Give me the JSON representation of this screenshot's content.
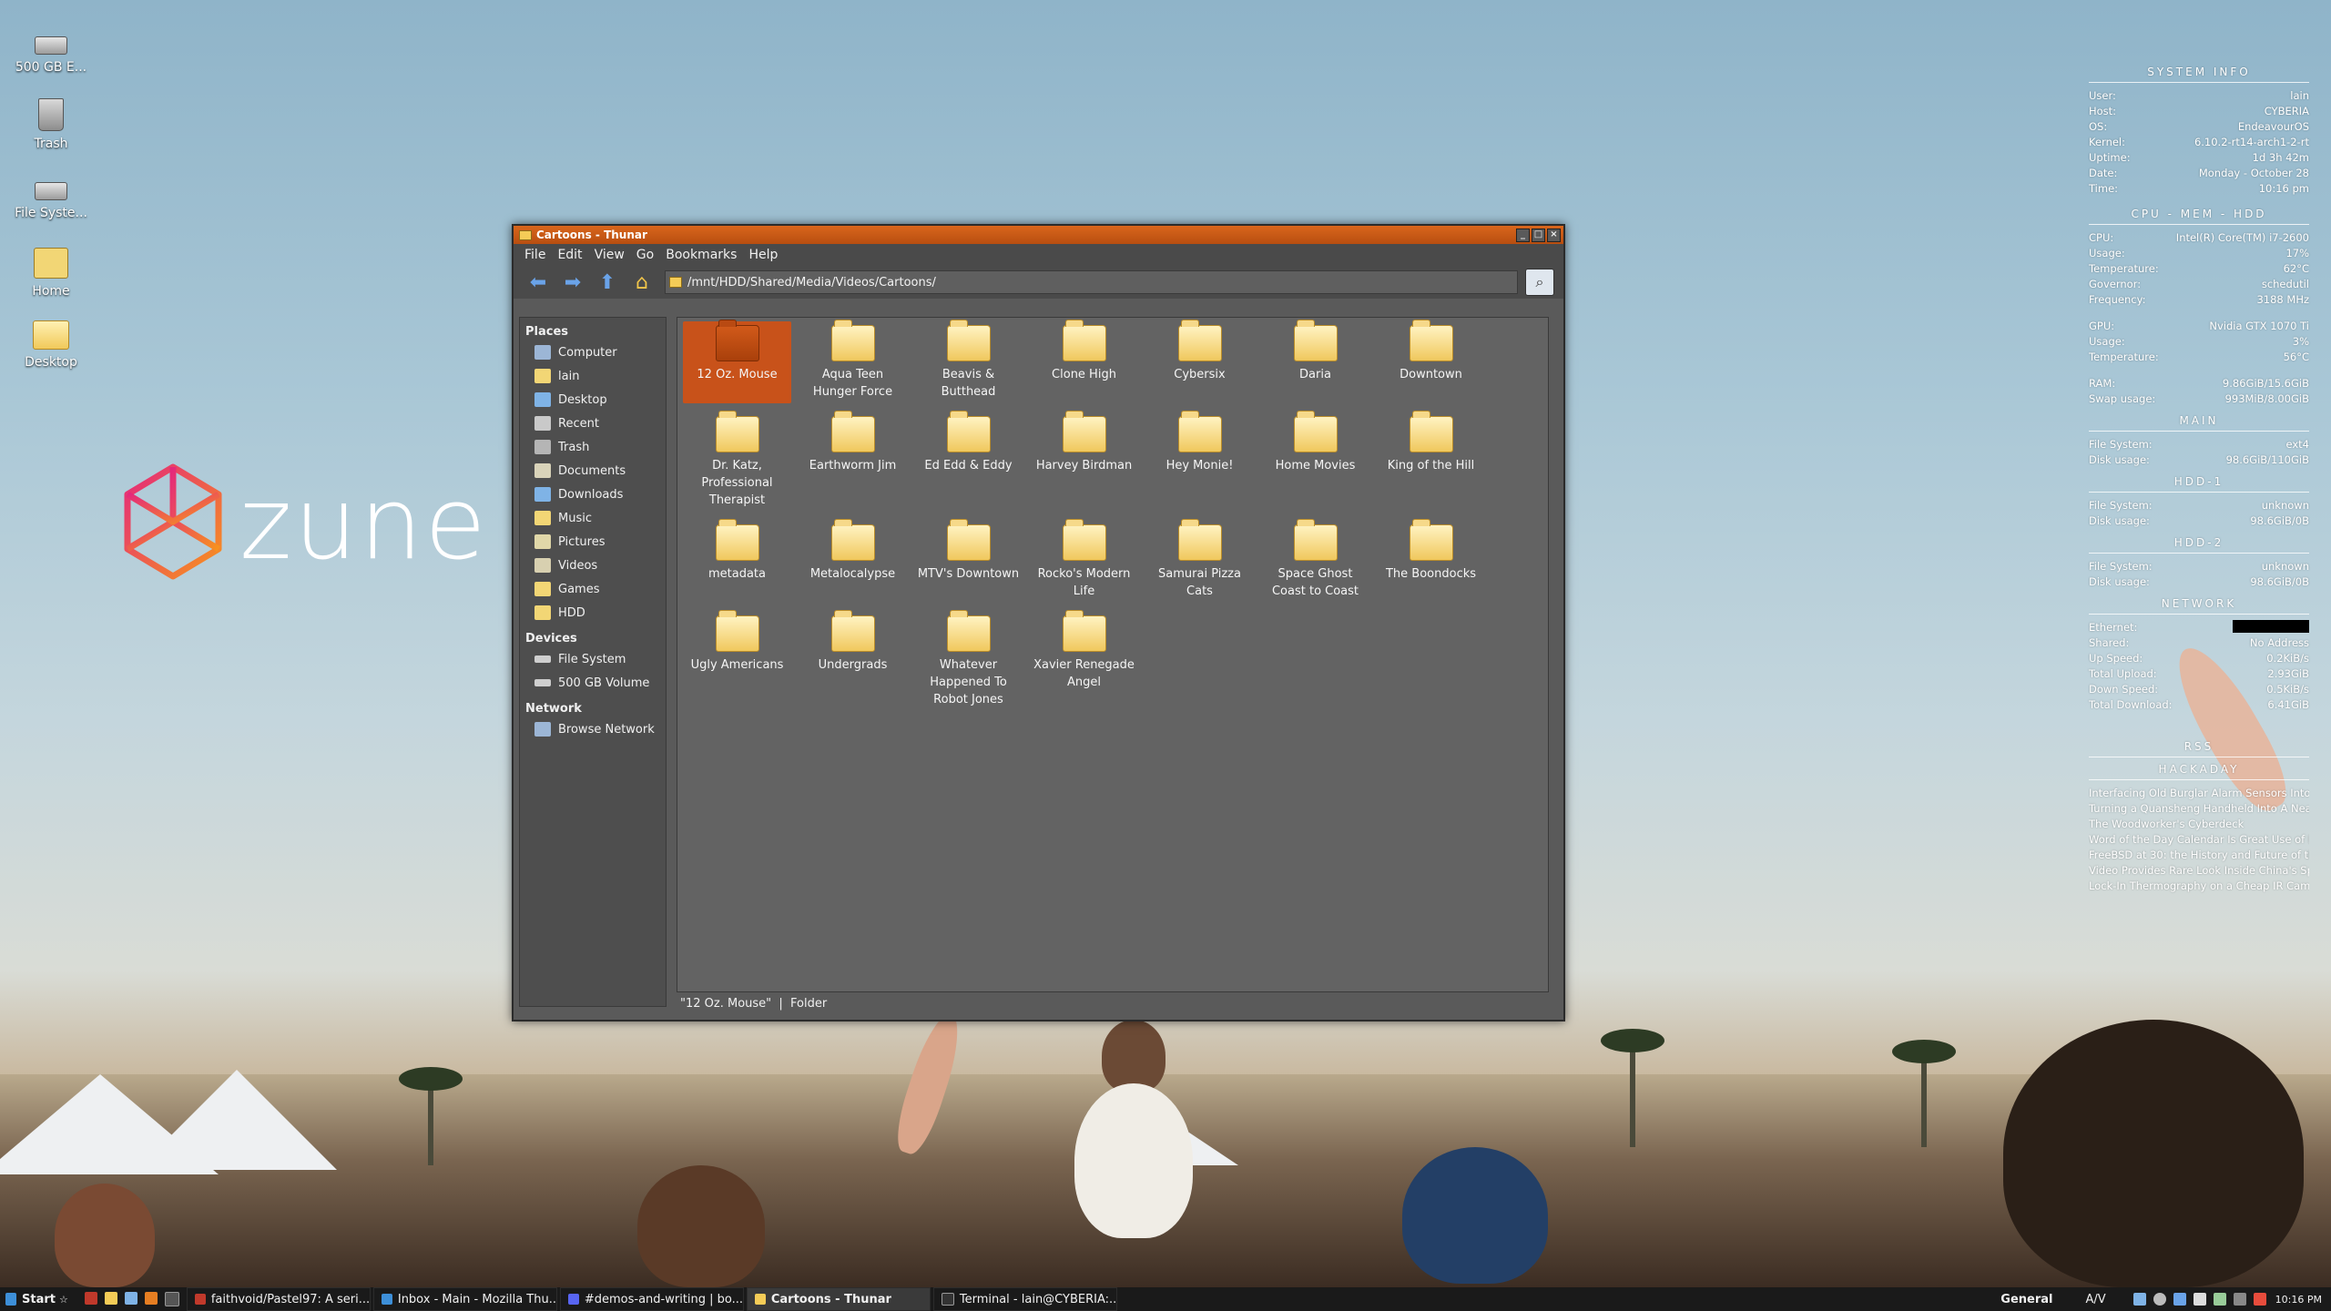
{
  "desktop_icons": [
    {
      "label": "500 GB E...",
      "icon": "drive-icon"
    },
    {
      "label": "Trash",
      "icon": "trash-icon"
    },
    {
      "label": "File Syste...",
      "icon": "drive-icon"
    },
    {
      "label": "Home",
      "icon": "home-icon"
    },
    {
      "label": "Desktop",
      "icon": "folder-icon"
    }
  ],
  "wallpaper_logo": "zune",
  "window": {
    "title": "Cartoons - Thunar",
    "menu": [
      "File",
      "Edit",
      "View",
      "Go",
      "Bookmarks",
      "Help"
    ],
    "address": "/mnt/HDD/Shared/Media/Videos/Cartoons/",
    "status": "\"12 Oz. Mouse\"  |  Folder",
    "accent": "#c8521a"
  },
  "sidebar": {
    "places_header": "Places",
    "places": [
      {
        "label": "Computer",
        "icon": "computer-icon"
      },
      {
        "label": "lain",
        "icon": "home-icon"
      },
      {
        "label": "Desktop",
        "icon": "desktop-icon"
      },
      {
        "label": "Recent",
        "icon": "recent-icon"
      },
      {
        "label": "Trash",
        "icon": "trash-icon"
      },
      {
        "label": "Documents",
        "icon": "documents-icon"
      },
      {
        "label": "Downloads",
        "icon": "downloads-icon"
      },
      {
        "label": "Music",
        "icon": "music-icon"
      },
      {
        "label": "Pictures",
        "icon": "pictures-icon"
      },
      {
        "label": "Videos",
        "icon": "videos-icon"
      },
      {
        "label": "Games",
        "icon": "folder-icon"
      },
      {
        "label": "HDD",
        "icon": "folder-icon"
      }
    ],
    "devices_header": "Devices",
    "devices": [
      {
        "label": "File System",
        "icon": "drive-icon"
      },
      {
        "label": "500 GB Volume",
        "icon": "drive-icon"
      }
    ],
    "network_header": "Network",
    "network": [
      {
        "label": "Browse Network",
        "icon": "network-icon"
      }
    ]
  },
  "folders": [
    "12 Oz. Mouse",
    "Aqua Teen Hunger Force",
    "Beavis & Butthead",
    "Clone High",
    "Cybersix",
    "Daria",
    "Downtown",
    "Dr. Katz, Professional Therapist",
    "Earthworm Jim",
    "Ed Edd & Eddy",
    "Harvey Birdman",
    "Hey Monie!",
    "Home Movies",
    "King of the Hill",
    "metadata",
    "Metalocalypse",
    "MTV's Downtown",
    "Rocko's Modern Life",
    "Samurai Pizza Cats",
    "Space Ghost Coast to Coast",
    "The Boondocks",
    "Ugly Americans",
    "Undergrads",
    "Whatever Happened To Robot Jones",
    "Xavier Renegade Angel"
  ],
  "selected_folder": "12 Oz. Mouse",
  "conky": {
    "system_header": "SYSTEM INFO",
    "system": [
      {
        "k": "User:",
        "v": "lain"
      },
      {
        "k": "Host:",
        "v": "CYBERIA"
      },
      {
        "k": "OS:",
        "v": "EndeavourOS"
      },
      {
        "k": "Kernel:",
        "v": "6.10.2-rt14-arch1-2-rt"
      },
      {
        "k": "Uptime:",
        "v": "1d 3h 42m"
      },
      {
        "k": "Date:",
        "v": "Monday - October 28"
      },
      {
        "k": "Time:",
        "v": "10:16 pm"
      }
    ],
    "cpu_header": "CPU - MEM - HDD",
    "cpu": [
      {
        "k": "CPU:",
        "v": "Intel(R) Core(TM) i7-2600"
      },
      {
        "k": "Usage:",
        "v": "17%"
      },
      {
        "k": "Temperature:",
        "v": "62°C"
      },
      {
        "k": "Governor:",
        "v": "schedutil"
      },
      {
        "k": "Frequency:",
        "v": "3188 MHz"
      }
    ],
    "gpu": [
      {
        "k": "GPU:",
        "v": "Nvidia GTX 1070 Ti"
      },
      {
        "k": "Usage:",
        "v": "3%"
      },
      {
        "k": "Temperature:",
        "v": "56°C"
      }
    ],
    "mem": [
      {
        "k": "RAM:",
        "v": "9.86GiB/15.6GiB"
      },
      {
        "k": "Swap usage:",
        "v": "993MiB/8.00GiB"
      }
    ],
    "main_header": "MAIN",
    "main": [
      {
        "k": "File System:",
        "v": "ext4"
      },
      {
        "k": "Disk usage:",
        "v": "98.6GiB/110GiB"
      }
    ],
    "hdd1_header": "HDD-1",
    "hdd1": [
      {
        "k": "File System:",
        "v": "unknown"
      },
      {
        "k": "Disk usage:",
        "v": "98.6GiB/0B"
      }
    ],
    "hdd2_header": "HDD-2",
    "hdd2": [
      {
        "k": "File System:",
        "v": "unknown"
      },
      {
        "k": "Disk usage:",
        "v": "98.6GiB/0B"
      }
    ],
    "network_header": "NETWORK",
    "network": [
      {
        "k": "Ethernet:",
        "v": ""
      },
      {
        "k": "Shared:",
        "v": "No Address"
      },
      {
        "k": "Up Speed:",
        "v": "0.2KiB/s"
      },
      {
        "k": "Total Upload:",
        "v": "2.93GiB"
      },
      {
        "k": "Down Speed:",
        "v": "0.5KiB/s"
      },
      {
        "k": "Total Download:",
        "v": "6.41GiB"
      }
    ],
    "rss_header": "RSS",
    "hackaday_header": "HACKADAY",
    "rss_items": [
      "Interfacing Old Burglar Alarm Sensors Into I",
      "Turning a Quansheng Handheld Into A Neat",
      "The Woodworker's Cyberdeck",
      "Word of the Day Calendar Is Great Use of E",
      "FreeBSD at 30: the History and Future of the",
      "Video Provides Rare Look Inside China's Spa",
      "Lock-In Thermography on a Cheap IR Came"
    ]
  },
  "taskbar": {
    "start": "Start",
    "tasks": [
      {
        "label": "faithvoid/Pastel97: A seri...",
        "active": false
      },
      {
        "label": "Inbox - Main - Mozilla Thu...",
        "active": false
      },
      {
        "label": "#demos-and-writing | bo...",
        "active": false
      },
      {
        "label": "Cartoons - Thunar",
        "active": true
      },
      {
        "label": "Terminal - lain@CYBERIA:...",
        "active": false
      }
    ],
    "general": "General",
    "av": "A/V",
    "clock": "10:16 PM"
  }
}
